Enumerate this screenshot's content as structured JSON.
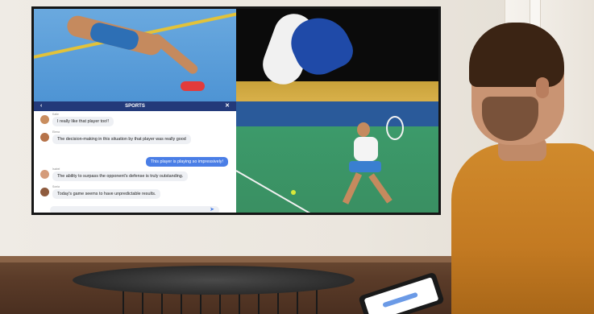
{
  "chat": {
    "title": "SPORTS",
    "back_icon": "chevron-left-icon",
    "close_icon": "close-icon",
    "messages": [
      {
        "sender": "Katie",
        "text": "I really like that player too!!",
        "avatar_color": "#c98d5e"
      },
      {
        "sender": "Elena",
        "text": "The decision-making in this situation by that player was really good",
        "avatar_color": "#b6734a"
      },
      {
        "sender": "Isabel",
        "text": "The ability to surpass the opponent's defense is truly outstanding.",
        "avatar_color": "#d49b7a"
      },
      {
        "sender": "Sonia",
        "text": "Today's game seems to have unpredictable results.",
        "avatar_color": "#8e5b3e"
      }
    ],
    "outgoing": "This player is playing so impressively!",
    "send_icon": "send-icon"
  },
  "colors": {
    "chat_header": "#233a7a",
    "outgoing_bubble": "#4a7ee6",
    "sweater": "#c37a22"
  }
}
